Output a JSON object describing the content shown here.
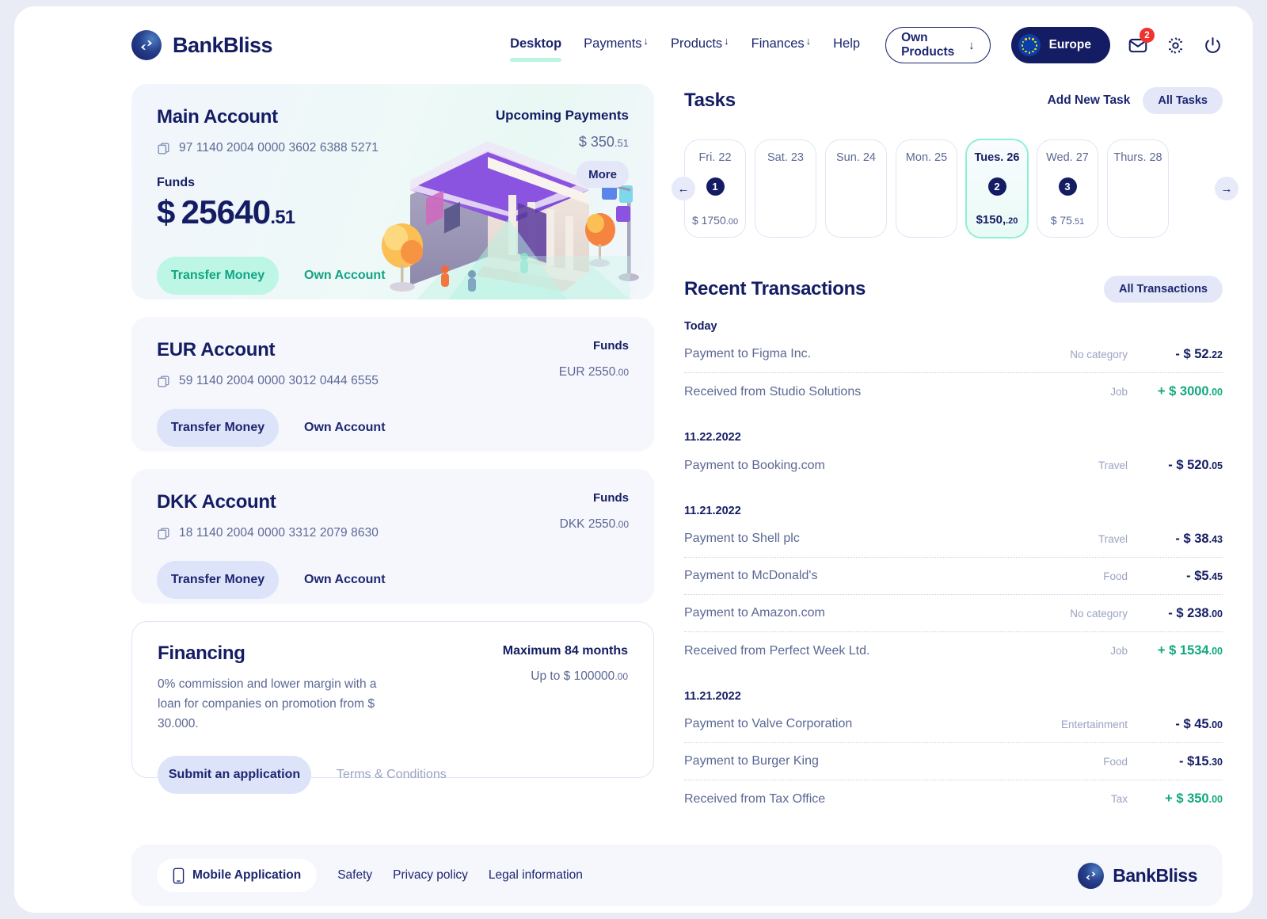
{
  "brand": {
    "name": "BankBliss"
  },
  "nav": {
    "items": [
      {
        "label": "Desktop",
        "caret": false,
        "active": true
      },
      {
        "label": "Payments",
        "caret": true,
        "active": false
      },
      {
        "label": "Products",
        "caret": true,
        "active": false
      },
      {
        "label": "Finances",
        "caret": true,
        "active": false
      },
      {
        "label": "Help",
        "caret": false,
        "active": false
      }
    ],
    "own_products": "Own Products",
    "own_products_arrow": "↓",
    "region": "Europe",
    "mail_badge": "2"
  },
  "main_account": {
    "title": "Main Account",
    "number": "97 1140 2004 0000 3602 6388 5271",
    "funds_label": "Funds",
    "currency": "$",
    "amount": "25640",
    "cents": ".51",
    "transfer_label": "Transfer Money",
    "own_account_label": "Own Account",
    "upcoming_title": "Upcoming Payments",
    "upcoming_amount": "$ 350",
    "upcoming_cents": ".51",
    "more_label": "More"
  },
  "accounts": [
    {
      "title": "EUR Account",
      "number": "59 1140 2004 0000 3012 0444 6555",
      "funds_label": "Funds",
      "funds_value": "EUR 2550",
      "funds_cents": ".00",
      "transfer_label": "Transfer Money",
      "own_account_label": "Own Account"
    },
    {
      "title": "DKK Account",
      "number": "18 1140 2004 0000 3312 2079 8630",
      "funds_label": "Funds",
      "funds_value": "DKK 2550",
      "funds_cents": ".00",
      "transfer_label": "Transfer Money",
      "own_account_label": "Own Account"
    }
  ],
  "financing": {
    "title": "Financing",
    "description": "0% commission and lower margin with a loan for companies on promotion from $ 30.000.",
    "max_label": "Maximum 84 months",
    "upto_label": "Up to $ 100000",
    "upto_cents": ".00",
    "submit_label": "Submit an application",
    "terms_label": "Terms & Conditions"
  },
  "tasks": {
    "title": "Tasks",
    "add_label": "Add New Task",
    "all_label": "All Tasks",
    "prev_arrow": "←",
    "next_arrow": "→",
    "days": [
      {
        "label": "Fri. 22",
        "count": "1",
        "amount": "$ 1750",
        "cents": ".00",
        "selected": false
      },
      {
        "label": "Sat. 23",
        "count": "",
        "amount": "",
        "cents": "",
        "selected": false
      },
      {
        "label": "Sun. 24",
        "count": "",
        "amount": "",
        "cents": "",
        "selected": false
      },
      {
        "label": "Mon. 25",
        "count": "",
        "amount": "",
        "cents": "",
        "selected": false
      },
      {
        "label": "Tues. 26",
        "count": "2",
        "amount": "$150,",
        "cents": ".20",
        "selected": true
      },
      {
        "label": "Wed. 27",
        "count": "3",
        "amount": "$ 75",
        "cents": ".51",
        "selected": false
      },
      {
        "label": "Thurs. 28",
        "count": "",
        "amount": "",
        "cents": "",
        "selected": false
      }
    ]
  },
  "transactions": {
    "title": "Recent Transactions",
    "all_label": "All Transactions",
    "groups": [
      {
        "date": "Today",
        "rows": [
          {
            "name": "Payment to  Figma Inc.",
            "category": "No category",
            "amount": "- $ 52",
            "cents": ".22",
            "positive": false
          },
          {
            "name": "Received from  Studio Solutions",
            "category": "Job",
            "amount": "+ $ 3000",
            "cents": ".00",
            "positive": true
          }
        ]
      },
      {
        "date": "11.22.2022",
        "rows": [
          {
            "name": "Payment to Booking.com",
            "category": "Travel",
            "amount": "- $ 520",
            "cents": ".05",
            "positive": false
          }
        ]
      },
      {
        "date": "11.21.2022",
        "rows": [
          {
            "name": "Payment to Shell plc",
            "category": "Travel",
            "amount": "- $ 38",
            "cents": ".43",
            "positive": false
          },
          {
            "name": "Payment to McDonald's",
            "category": "Food",
            "amount": "- $5",
            "cents": ".45",
            "positive": false
          },
          {
            "name": "Payment to Amazon.com",
            "category": "No category",
            "amount": "- $ 238",
            "cents": ".00",
            "positive": false
          },
          {
            "name": "Received from Perfect Week Ltd.",
            "category": "Job",
            "amount": "+ $ 1534",
            "cents": ".00",
            "positive": true
          }
        ]
      },
      {
        "date": "11.21.2022",
        "rows": [
          {
            "name": "Payment to Valve Corporation",
            "category": "Entertainment",
            "amount": "- $ 45",
            "cents": ".00",
            "positive": false
          },
          {
            "name": "Payment to Burger King",
            "category": "Food",
            "amount": "- $15",
            "cents": ".30",
            "positive": false
          },
          {
            "name": "Received from Tax Office",
            "category": "Tax",
            "amount": "+ $ 350",
            "cents": ".00",
            "positive": true
          }
        ]
      }
    ]
  },
  "footer": {
    "mobile_label": "Mobile Application",
    "links": [
      "Safety",
      "Privacy policy",
      "Legal information"
    ],
    "brand": "BankBliss"
  },
  "colors": {
    "navy": "#141d63",
    "green": "#0fa87f",
    "mint": "#bdf6e4",
    "lavender": "#dde3f8",
    "red": "#f1332e"
  }
}
